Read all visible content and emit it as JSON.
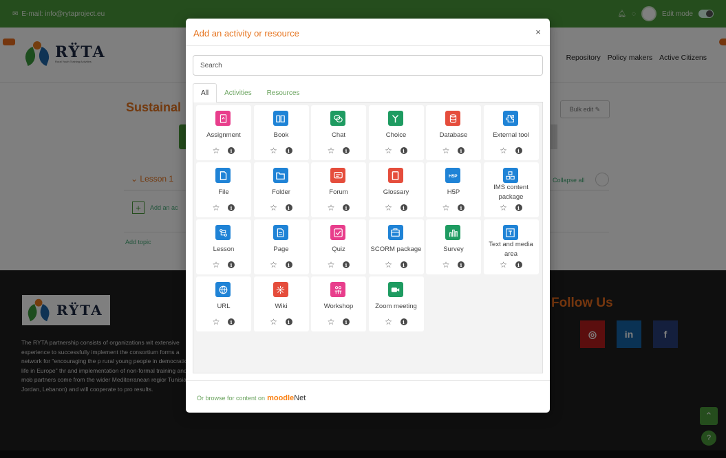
{
  "topbar": {
    "email": "E-mail: info@rytaproject.eu",
    "edit_mode": "Edit mode"
  },
  "brand": {
    "logo_text": "RŸTA",
    "logo_sub": "Rural Youth Training Activities"
  },
  "nav": {
    "links": [
      "Repository",
      "Policy makers",
      "Active Citizens"
    ]
  },
  "course": {
    "title": "Sustainal",
    "bulk_edit": "Bulk edit",
    "lesson_title": "Lesson 1",
    "collapse_all": "Collapse all",
    "add_activity": "Add an ac",
    "add_topic": "Add topic"
  },
  "footer": {
    "about": "The RYTA partnership consists of organizations wit extensive experience to successfully implement the consortium forms a network for \"encouraging the p rural young people in democratic life in Europe\" thr and implementation of non-formal training and mob partners come from the wider Mediterranean regior Tunisia, Jordan, Lebanon) and will cooperate to pro results.",
    "follow_title": "Follow Us",
    "social": [
      {
        "name": "instagram",
        "glyph": "◎",
        "color": "#b71c1c"
      },
      {
        "name": "linkedin",
        "glyph": "in",
        "color": "#1565a8"
      },
      {
        "name": "facebook",
        "glyph": "f",
        "color": "#283e7a"
      }
    ]
  },
  "modal": {
    "title": "Add an activity or resource",
    "close": "×",
    "search_placeholder": "Search",
    "tabs": [
      "All",
      "Activities",
      "Resources"
    ],
    "active_tab": "All",
    "items": [
      {
        "label": "Assignment",
        "icon": "assignment-icon",
        "color": "#e83e8c"
      },
      {
        "label": "Book",
        "icon": "book-icon",
        "color": "#1f83d6"
      },
      {
        "label": "Chat",
        "icon": "chat-icon",
        "color": "#1e9b61"
      },
      {
        "label": "Choice",
        "icon": "choice-icon",
        "color": "#1e9b61"
      },
      {
        "label": "Database",
        "icon": "database-icon",
        "color": "#e54d3c"
      },
      {
        "label": "External tool",
        "icon": "external-tool-icon",
        "color": "#1f83d6"
      },
      {
        "label": "File",
        "icon": "file-icon",
        "color": "#1f83d6"
      },
      {
        "label": "Folder",
        "icon": "folder-icon",
        "color": "#1f83d6"
      },
      {
        "label": "Forum",
        "icon": "forum-icon",
        "color": "#e54d3c"
      },
      {
        "label": "Glossary",
        "icon": "glossary-icon",
        "color": "#e54d3c"
      },
      {
        "label": "H5P",
        "icon": "h5p-icon",
        "color": "#1f83d6"
      },
      {
        "label": "IMS content package",
        "icon": "ims-package-icon",
        "color": "#1f83d6"
      },
      {
        "label": "Lesson",
        "icon": "lesson-icon",
        "color": "#1f83d6"
      },
      {
        "label": "Page",
        "icon": "page-icon",
        "color": "#1f83d6"
      },
      {
        "label": "Quiz",
        "icon": "quiz-icon",
        "color": "#e83e8c"
      },
      {
        "label": "SCORM package",
        "icon": "scorm-icon",
        "color": "#1f83d6"
      },
      {
        "label": "Survey",
        "icon": "survey-icon",
        "color": "#1e9b61"
      },
      {
        "label": "Text and media area",
        "icon": "text-media-icon",
        "color": "#1f83d6"
      },
      {
        "label": "URL",
        "icon": "url-icon",
        "color": "#1f83d6"
      },
      {
        "label": "Wiki",
        "icon": "wiki-icon",
        "color": "#e54d3c"
      },
      {
        "label": "Workshop",
        "icon": "workshop-icon",
        "color": "#e83e8c"
      },
      {
        "label": "Zoom meeting",
        "icon": "zoom-icon",
        "color": "#1e9b61"
      }
    ],
    "footer": {
      "browse_prefix": "Or browse for content on",
      "brand_a": "moodle",
      "brand_b": "Net"
    }
  }
}
